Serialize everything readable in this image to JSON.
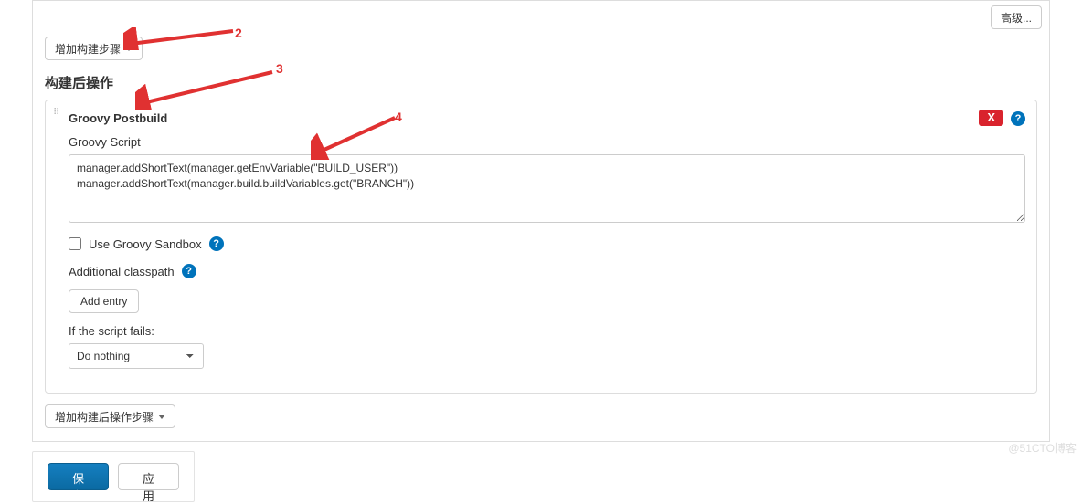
{
  "top": {
    "advanced_btn": "高级..."
  },
  "build_steps": {
    "add_step_btn": "增加构建步骤"
  },
  "post_build": {
    "section_title": "构建后操作",
    "step_title": "Groovy Postbuild",
    "groovy_script_label": "Groovy Script",
    "groovy_script_value": "manager.addShortText(manager.getEnvVariable(\"BUILD_USER\"))\nmanager.addShortText(manager.build.buildVariables.get(\"BRANCH\"))",
    "sandbox_label": "Use Groovy Sandbox",
    "additional_classpath_label": "Additional classpath",
    "add_entry_btn": "Add entry",
    "script_fails_label": "If the script fails:",
    "script_fails_value": "Do nothing",
    "add_post_btn": "增加构建后操作步骤",
    "delete_label": "X"
  },
  "footer": {
    "save": "保存",
    "apply": "应用"
  },
  "annotations": {
    "n2": "2",
    "n3": "3",
    "n4": "4"
  },
  "watermark": "@51CTO博客"
}
